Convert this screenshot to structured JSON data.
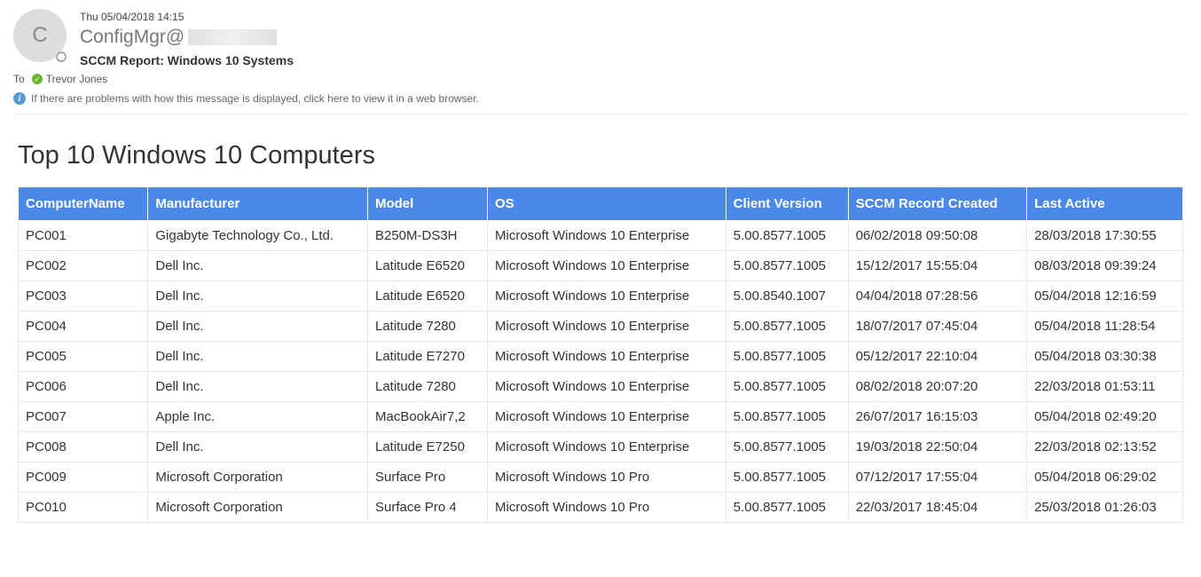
{
  "email": {
    "avatar_initial": "C",
    "timestamp": "Thu 05/04/2018 14:15",
    "sender": "ConfigMgr@",
    "subject": "SCCM Report: Windows 10 Systems",
    "to_label": "To",
    "recipient": "Trevor Jones",
    "info_message": "If there are problems with how this message is displayed, click here to view it in a web browser."
  },
  "report": {
    "title": "Top 10 Windows 10 Computers",
    "headers": [
      "ComputerName",
      "Manufacturer",
      "Model",
      "OS",
      "Client Version",
      "SCCM Record Created",
      "Last Active"
    ],
    "rows": [
      [
        "PC001",
        "Gigabyte Technology Co., Ltd.",
        "B250M-DS3H",
        "Microsoft Windows 10 Enterprise",
        "5.00.8577.1005",
        "06/02/2018 09:50:08",
        "28/03/2018 17:30:55"
      ],
      [
        "PC002",
        "Dell Inc.",
        "Latitude E6520",
        "Microsoft Windows 10 Enterprise",
        "5.00.8577.1005",
        "15/12/2017 15:55:04",
        "08/03/2018 09:39:24"
      ],
      [
        "PC003",
        "Dell Inc.",
        "Latitude E6520",
        "Microsoft Windows 10 Enterprise",
        "5.00.8540.1007",
        "04/04/2018 07:28:56",
        "05/04/2018 12:16:59"
      ],
      [
        "PC004",
        "Dell Inc.",
        "Latitude 7280",
        "Microsoft Windows 10 Enterprise",
        "5.00.8577.1005",
        "18/07/2017 07:45:04",
        "05/04/2018 11:28:54"
      ],
      [
        "PC005",
        "Dell Inc.",
        "Latitude E7270",
        "Microsoft Windows 10 Enterprise",
        "5.00.8577.1005",
        "05/12/2017 22:10:04",
        "05/04/2018 03:30:38"
      ],
      [
        "PC006",
        "Dell Inc.",
        "Latitude 7280",
        "Microsoft Windows 10 Enterprise",
        "5.00.8577.1005",
        "08/02/2018 20:07:20",
        "22/03/2018 01:53:11"
      ],
      [
        "PC007",
        "Apple Inc.",
        "MacBookAir7,2",
        "Microsoft Windows 10 Enterprise",
        "5.00.8577.1005",
        "26/07/2017 16:15:03",
        "05/04/2018 02:49:20"
      ],
      [
        "PC008",
        "Dell Inc.",
        "Latitude E7250",
        "Microsoft Windows 10 Enterprise",
        "5.00.8577.1005",
        "19/03/2018 22:50:04",
        "22/03/2018 02:13:52"
      ],
      [
        "PC009",
        "Microsoft Corporation",
        "Surface Pro",
        "Microsoft Windows 10 Pro",
        "5.00.8577.1005",
        "07/12/2017 17:55:04",
        "05/04/2018 06:29:02"
      ],
      [
        "PC010",
        "Microsoft Corporation",
        "Surface Pro 4",
        "Microsoft Windows 10 Pro",
        "5.00.8577.1005",
        "22/03/2017 18:45:04",
        "25/03/2018 01:26:03"
      ]
    ]
  }
}
